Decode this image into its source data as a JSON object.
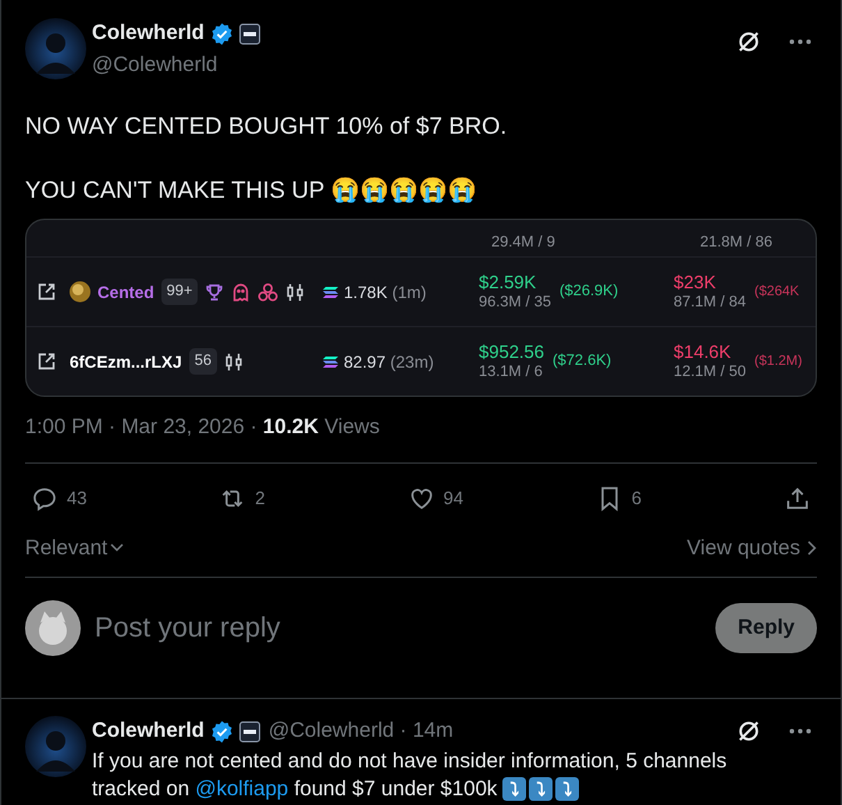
{
  "post": {
    "author": "Colewherld",
    "handle": "@Colewherld",
    "lines": [
      "NO WAY CENTED BOUGHT 10% of $7 BRO.",
      "YOU CAN'T MAKE THIS UP 😭😭😭😭😭"
    ],
    "embed": {
      "rows": [
        {
          "kind": "partial",
          "buy_sub": "29.4M / 9",
          "sell_sub": "21.8M / 86"
        },
        {
          "kind": "full",
          "name": "Cented",
          "color": "#b66ee8",
          "has_avatar": true,
          "count": "99+",
          "markers": [
            {
              "kind": "trophy"
            },
            {
              "kind": "ghost"
            },
            {
              "kind": "cluster"
            },
            {
              "kind": "candles"
            }
          ],
          "amount": "1.78K",
          "age": "(1m)",
          "buy": "$2.59K",
          "buy_sub": "96.3M / 35",
          "buy_usd": "($26.9K)",
          "sell": "$23K",
          "sell_sub": "87.1M / 84",
          "sell_usd": "($264K"
        },
        {
          "kind": "full",
          "name": "6fCEzm...rLXJ",
          "color": "#ffffff",
          "has_avatar": false,
          "count": "56",
          "markers": [
            {
              "kind": "candles"
            }
          ],
          "amount": "82.97",
          "age": "(23m)",
          "buy": "$952.56",
          "buy_sub": "13.1M / 6",
          "buy_usd": "($72.6K)",
          "sell": "$14.6K",
          "sell_sub": "12.1M / 50",
          "sell_usd": "($1.2M)"
        }
      ]
    },
    "time": "1:00 PM · Mar 23, 2026 ·",
    "views": "10.2K",
    "views_label": "Views",
    "actions": [
      {
        "kind": "reply",
        "count": "43"
      },
      {
        "kind": "repost",
        "count": "2"
      },
      {
        "kind": "like",
        "count": "94"
      },
      {
        "kind": "bookmark",
        "count": "6"
      },
      {
        "kind": "share"
      }
    ],
    "sort": "Relevant",
    "view_quotes": "View quotes"
  },
  "composer": {
    "placeholder": "Post your reply",
    "button": "Reply"
  },
  "reply": {
    "author": "Colewherld",
    "handle": "@Colewherld · 14m",
    "text_before": "If you are not cented and do not have insider information, 5 channels tracked on ",
    "mention": "@kolfiapp",
    "text_after": " found $7 under $100k ",
    "arrows": [
      "⤵",
      "⤵",
      "⤵"
    ]
  }
}
